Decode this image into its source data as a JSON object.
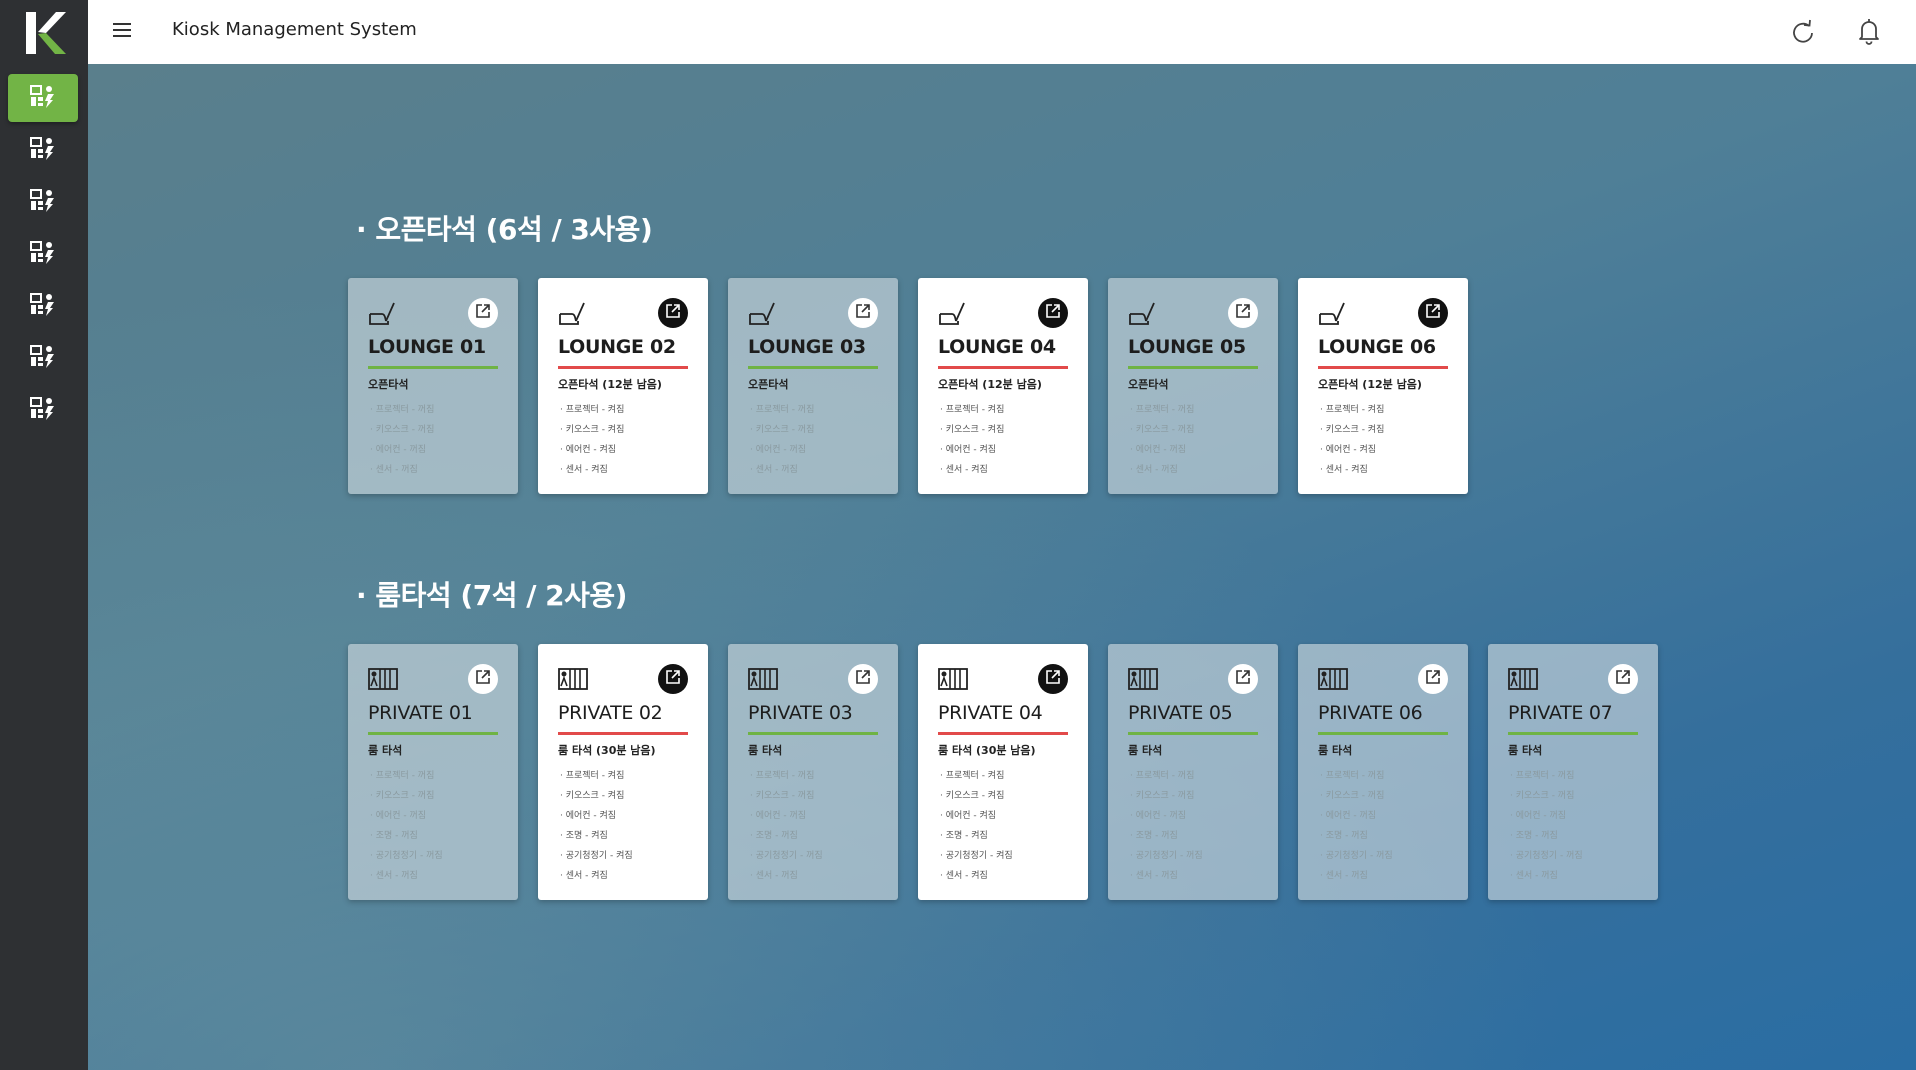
{
  "app": {
    "title": "Kiosk Management System"
  },
  "sidebar": {
    "items": [
      {
        "icon": "kiosk-icon",
        "active": true
      },
      {
        "icon": "kiosk-icon",
        "active": false
      },
      {
        "icon": "kiosk-icon",
        "active": false
      },
      {
        "icon": "kiosk-icon",
        "active": false
      },
      {
        "icon": "kiosk-icon",
        "active": false
      },
      {
        "icon": "kiosk-icon",
        "active": false
      },
      {
        "icon": "kiosk-icon",
        "active": false
      }
    ]
  },
  "colors": {
    "active_green": "#72b446",
    "in_use_red": "#e24a4a",
    "header_bg": "#ffffff",
    "sidebar_bg": "#2e3033"
  },
  "sections": {
    "open": {
      "title": "· 오픈타석 (6석 / 3사용)",
      "cards": [
        {
          "name": "LOUNGE 01",
          "status": "오픈타석",
          "in_use": false,
          "devices": [
            "· 프로젝터 - 꺼짐",
            "· 키오스크 - 꺼짐",
            "· 에어컨 - 꺼짐",
            "· 센서 - 꺼짐"
          ]
        },
        {
          "name": "LOUNGE 02",
          "status": "오픈타석 (12분 남음)",
          "in_use": true,
          "devices": [
            "· 프로젝터 - 켜짐",
            "· 키오스크 - 켜짐",
            "· 에어컨 - 켜짐",
            "· 센서 - 켜짐"
          ]
        },
        {
          "name": "LOUNGE 03",
          "status": "오픈타석",
          "in_use": false,
          "devices": [
            "· 프로젝터 - 꺼짐",
            "· 키오스크 - 꺼짐",
            "· 에어컨 - 꺼짐",
            "· 센서 - 꺼짐"
          ]
        },
        {
          "name": "LOUNGE 04",
          "status": "오픈타석 (12분 남음)",
          "in_use": true,
          "devices": [
            "· 프로젝터 - 켜짐",
            "· 키오스크 - 켜짐",
            "· 에어컨 - 켜짐",
            "· 센서 - 켜짐"
          ]
        },
        {
          "name": "LOUNGE 05",
          "status": "오픈타석",
          "in_use": false,
          "devices": [
            "· 프로젝터 - 꺼짐",
            "· 키오스크 - 꺼짐",
            "· 에어컨 - 꺼짐",
            "· 센서 - 꺼짐"
          ]
        },
        {
          "name": "LOUNGE 06",
          "status": "오픈타석 (12분 남음)",
          "in_use": true,
          "devices": [
            "· 프로젝터 - 켜짐",
            "· 키오스크 - 켜짐",
            "· 에어컨 - 켜짐",
            "· 센서 - 켜짐"
          ]
        }
      ]
    },
    "room": {
      "title": "· 룸타석 (7석 / 2사용)",
      "cards": [
        {
          "name": "PRIVATE 01",
          "status": "룸 타석",
          "in_use": false,
          "devices": [
            "· 프로젝터 - 꺼짐",
            "· 키오스크 - 꺼짐",
            "· 에어컨 - 꺼짐",
            "· 조명 - 꺼짐",
            "· 공기청정기 - 꺼짐",
            "· 센서 - 꺼짐"
          ]
        },
        {
          "name": "PRIVATE 02",
          "status": "룸 타석 (30분 남음)",
          "in_use": true,
          "devices": [
            "· 프로젝터 - 켜짐",
            "· 키오스크 - 켜짐",
            "· 에어컨 - 켜짐",
            "· 조명 - 켜짐",
            "· 공기청정기 - 켜짐",
            "· 센서 - 켜짐"
          ]
        },
        {
          "name": "PRIVATE 03",
          "status": "룸 타석",
          "in_use": false,
          "devices": [
            "· 프로젝터 - 꺼짐",
            "· 키오스크 - 꺼짐",
            "· 에어컨 - 꺼짐",
            "· 조명 - 꺼짐",
            "· 공기청정기 - 꺼짐",
            "· 센서 - 꺼짐"
          ]
        },
        {
          "name": "PRIVATE 04",
          "status": "룸 타석 (30분 남음)",
          "in_use": true,
          "devices": [
            "· 프로젝터 - 켜짐",
            "· 키오스크 - 켜짐",
            "· 에어컨 - 켜짐",
            "· 조명 - 켜짐",
            "· 공기청정기 - 켜짐",
            "· 센서 - 켜짐"
          ]
        },
        {
          "name": "PRIVATE 05",
          "status": "룸 타석",
          "in_use": false,
          "devices": [
            "· 프로젝터 - 꺼짐",
            "· 키오스크 - 꺼짐",
            "· 에어컨 - 꺼짐",
            "· 조명 - 꺼짐",
            "· 공기청정기 - 꺼짐",
            "· 센서 - 꺼짐"
          ]
        },
        {
          "name": "PRIVATE 06",
          "status": "룸 타석",
          "in_use": false,
          "devices": [
            "· 프로젝터 - 꺼짐",
            "· 키오스크 - 꺼짐",
            "· 에어컨 - 꺼짐",
            "· 조명 - 꺼짐",
            "· 공기청정기 - 꺼짐",
            "· 센서 - 꺼짐"
          ]
        },
        {
          "name": "PRIVATE 07",
          "status": "룸 타석",
          "in_use": false,
          "devices": [
            "· 프로젝터 - 꺼짐",
            "· 키오스크 - 꺼짐",
            "· 에어컨 - 꺼짐",
            "· 조명 - 꺼짐",
            "· 공기청정기 - 꺼짐",
            "· 센서 - 꺼짐"
          ]
        }
      ]
    }
  }
}
